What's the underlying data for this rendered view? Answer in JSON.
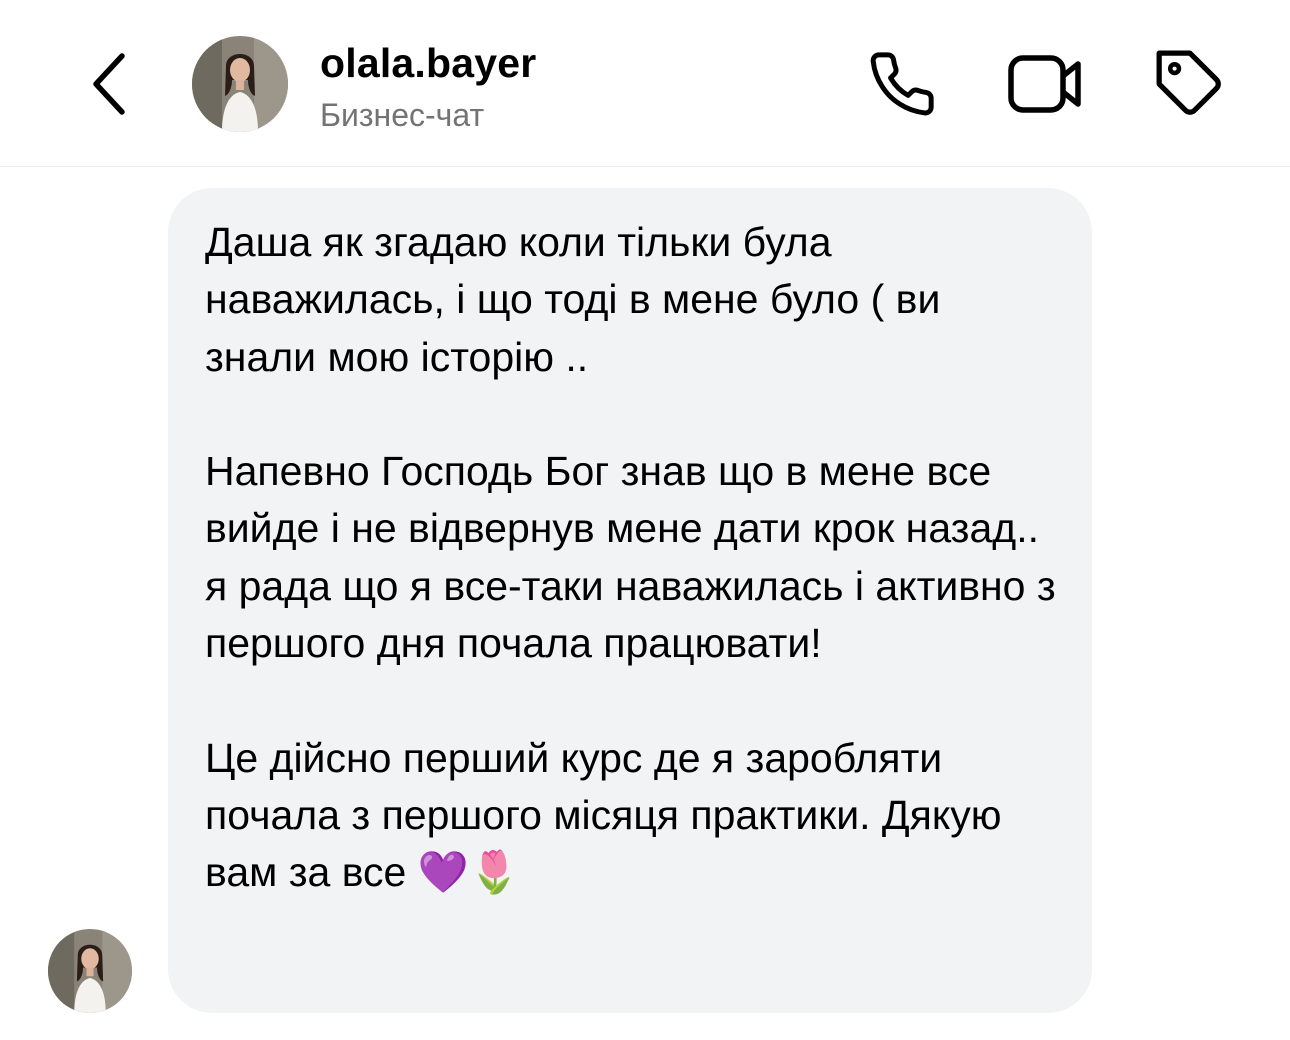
{
  "header": {
    "back_icon": "chevron-left-icon",
    "username": "olala.bayer",
    "subtitle": "Бизнес-чат",
    "actions": [
      {
        "name": "phone-icon"
      },
      {
        "name": "video-camera-icon"
      },
      {
        "name": "tag-icon"
      }
    ]
  },
  "message": {
    "paragraphs": [
      "Даша як згадаю коли тільки була наважилась, і що тоді в мене було ( ви знали мою історію ..",
      "Напевно Господь Бог знав що в мене все вийде і не відвернув мене дати крок назад.. я рада що я все-таки наважилась і активно з першого дня почала працювати!",
      "Це дійсно перший курс де я заробляти почала з першого місяця практики. Дякую вам за все 💜🌷"
    ]
  },
  "colors": {
    "bubble_bg": "#f2f3f5",
    "subtitle": "#737373",
    "divider": "#ececec"
  }
}
